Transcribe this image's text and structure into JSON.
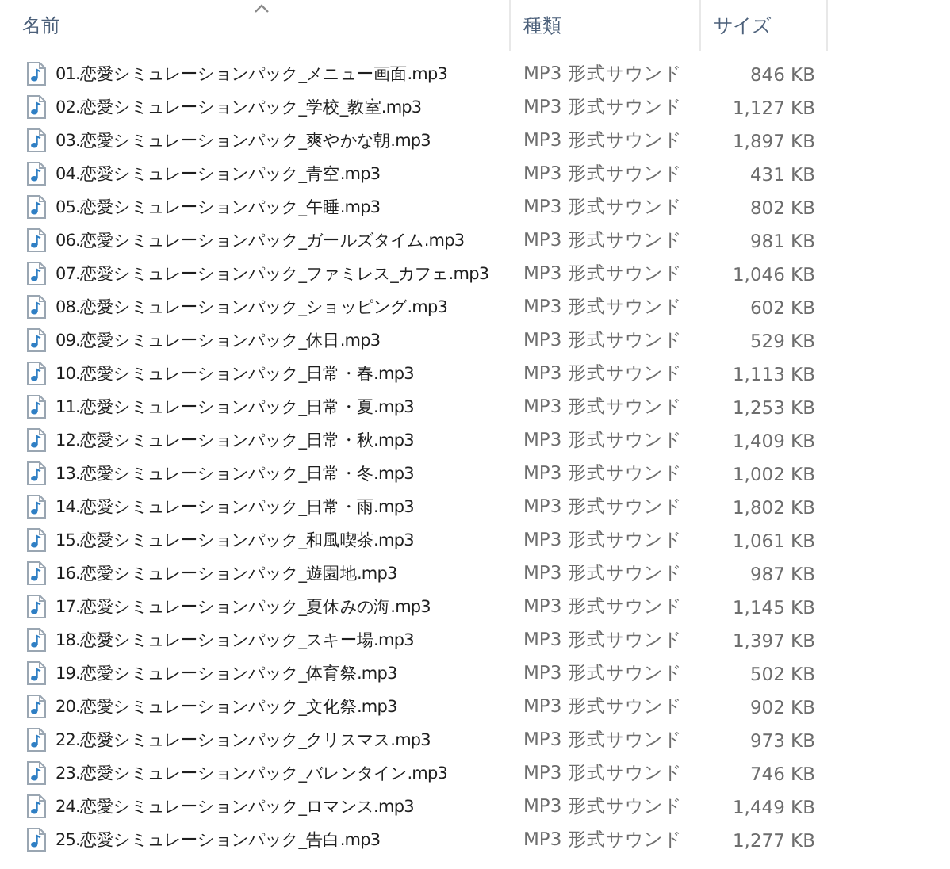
{
  "columns": [
    {
      "label": "名前",
      "sorted": true
    },
    {
      "label": "種類",
      "sorted": false
    },
    {
      "label": "サイズ",
      "sorted": false
    }
  ],
  "files": [
    {
      "name": "01.恋愛シミュレーションパック_メニュー画面.mp3",
      "type": "MP3 形式サウンド",
      "size": "846 KB"
    },
    {
      "name": "02.恋愛シミュレーションパック_学校_教室.mp3",
      "type": "MP3 形式サウンド",
      "size": "1,127 KB"
    },
    {
      "name": "03.恋愛シミュレーションパック_爽やかな朝.mp3",
      "type": "MP3 形式サウンド",
      "size": "1,897 KB"
    },
    {
      "name": "04.恋愛シミュレーションパック_青空.mp3",
      "type": "MP3 形式サウンド",
      "size": "431 KB"
    },
    {
      "name": "05.恋愛シミュレーションパック_午睡.mp3",
      "type": "MP3 形式サウンド",
      "size": "802 KB"
    },
    {
      "name": "06.恋愛シミュレーションパック_ガールズタイム.mp3",
      "type": "MP3 形式サウンド",
      "size": "981 KB"
    },
    {
      "name": "07.恋愛シミュレーションパック_ファミレス_カフェ.mp3",
      "type": "MP3 形式サウンド",
      "size": "1,046 KB"
    },
    {
      "name": "08.恋愛シミュレーションパック_ショッピング.mp3",
      "type": "MP3 形式サウンド",
      "size": "602 KB"
    },
    {
      "name": "09.恋愛シミュレーションパック_休日.mp3",
      "type": "MP3 形式サウンド",
      "size": "529 KB"
    },
    {
      "name": "10.恋愛シミュレーションパック_日常・春.mp3",
      "type": "MP3 形式サウンド",
      "size": "1,113 KB"
    },
    {
      "name": "11.恋愛シミュレーションパック_日常・夏.mp3",
      "type": "MP3 形式サウンド",
      "size": "1,253 KB"
    },
    {
      "name": "12.恋愛シミュレーションパック_日常・秋.mp3",
      "type": "MP3 形式サウンド",
      "size": "1,409 KB"
    },
    {
      "name": "13.恋愛シミュレーションパック_日常・冬.mp3",
      "type": "MP3 形式サウンド",
      "size": "1,002 KB"
    },
    {
      "name": "14.恋愛シミュレーションパック_日常・雨.mp3",
      "type": "MP3 形式サウンド",
      "size": "1,802 KB"
    },
    {
      "name": "15.恋愛シミュレーションパック_和風喫茶.mp3",
      "type": "MP3 形式サウンド",
      "size": "1,061 KB"
    },
    {
      "name": "16.恋愛シミュレーションパック_遊園地.mp3",
      "type": "MP3 形式サウンド",
      "size": "987 KB"
    },
    {
      "name": "17.恋愛シミュレーションパック_夏休みの海.mp3",
      "type": "MP3 形式サウンド",
      "size": "1,145 KB"
    },
    {
      "name": "18.恋愛シミュレーションパック_スキー場.mp3",
      "type": "MP3 形式サウンド",
      "size": "1,397 KB"
    },
    {
      "name": "19.恋愛シミュレーションパック_体育祭.mp3",
      "type": "MP3 形式サウンド",
      "size": "502 KB"
    },
    {
      "name": "20.恋愛シミュレーションパック_文化祭.mp3",
      "type": "MP3 形式サウンド",
      "size": "902 KB"
    },
    {
      "name": "22.恋愛シミュレーションパック_クリスマス.mp3",
      "type": "MP3 形式サウンド",
      "size": "973 KB"
    },
    {
      "name": "23.恋愛シミュレーションパック_バレンタイン.mp3",
      "type": "MP3 形式サウンド",
      "size": "746 KB"
    },
    {
      "name": "24.恋愛シミュレーションパック_ロマンス.mp3",
      "type": "MP3 形式サウンド",
      "size": "1,449 KB"
    },
    {
      "name": "25.恋愛シミュレーションパック_告白.mp3",
      "type": "MP3 形式サウンド",
      "size": "1,277 KB"
    }
  ]
}
